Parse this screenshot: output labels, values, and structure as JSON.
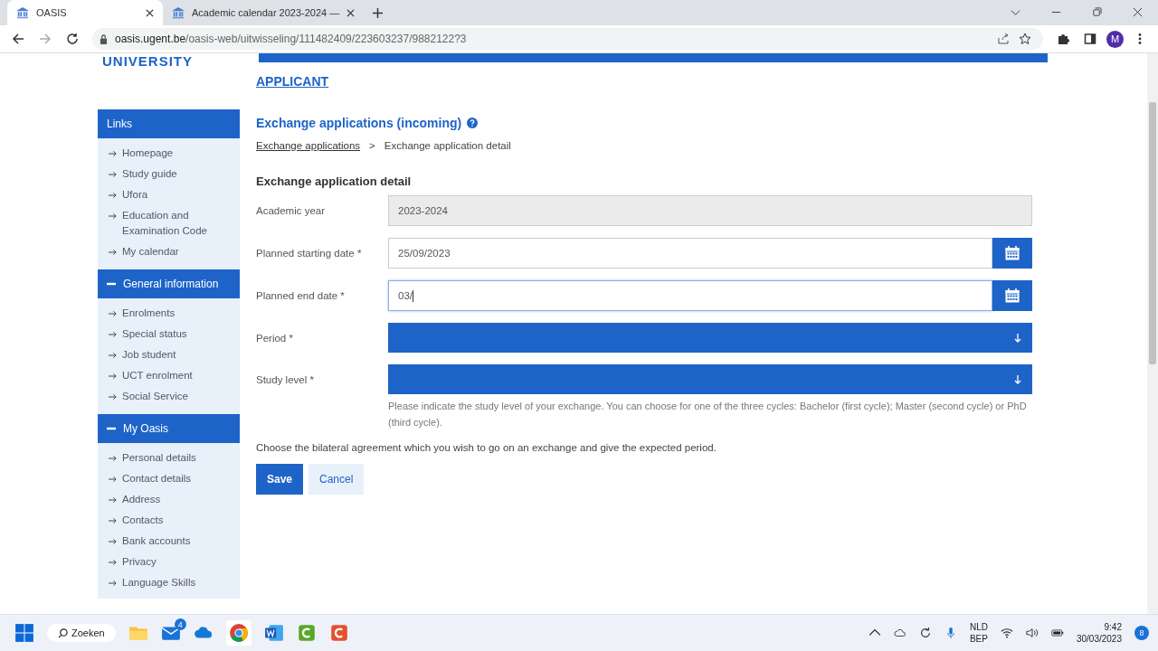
{
  "browser": {
    "tabs": [
      {
        "title": "OASIS",
        "selected": true
      },
      {
        "title": "Academic calendar 2023-2024 —",
        "selected": false
      }
    ],
    "url": {
      "host": "oasis.ugent.be",
      "path": "/oasis-web/uitwisseling/111482409/223603237/9882122?3"
    },
    "profile": "M"
  },
  "page": {
    "logo_text": "UNIVERSITY",
    "section_link": "APPLICANT",
    "sidebar": [
      {
        "title": "Links",
        "kind": "header",
        "items": [
          "Homepage",
          "Study guide",
          "Ufora",
          "Education and Examination Code",
          "My calendar"
        ]
      },
      {
        "title": "General information",
        "kind": "toggle",
        "expanded": true,
        "items": [
          "Enrolments",
          "Special status",
          "Job student",
          "UCT enrolment",
          "Social Service"
        ]
      },
      {
        "title": "My Oasis",
        "kind": "toggle",
        "expanded": true,
        "items": [
          "Personal details",
          "Contact details",
          "Address",
          "Contacts",
          "Bank accounts",
          "Privacy",
          "Language Skills"
        ]
      }
    ],
    "heading": "Exchange applications (incoming)",
    "breadcrumb": {
      "items": [
        {
          "label": "Exchange applications",
          "link": true
        },
        {
          "label": "Exchange application detail",
          "link": false
        }
      ],
      "separator": ">"
    },
    "form_title": "Exchange application detail",
    "fields": [
      {
        "label": "Academic year",
        "kind": "readonly",
        "value": "2023-2024"
      },
      {
        "label": "Planned starting date *",
        "kind": "date",
        "value": "25/09/2023",
        "focused": false
      },
      {
        "label": "Planned end date *",
        "kind": "date",
        "value": "03/",
        "focused": true
      },
      {
        "label": "Period *",
        "kind": "select"
      },
      {
        "label": "Study level *",
        "kind": "select",
        "help": "Please indicate the study level of your exchange. You can choose for one of the three cycles: Bachelor (first cycle); Master (second cycle) or PhD (third cycle)."
      }
    ],
    "note": "Choose the bilateral agreement which you wish to go on an exchange and give the expected period.",
    "buttons": [
      {
        "label": "Save",
        "kind": "primary"
      },
      {
        "label": "Cancel",
        "kind": "secondary"
      }
    ]
  },
  "taskbar": {
    "search": "Zoeken",
    "mail_badge": "4",
    "language": "NLD",
    "layout": "BEP",
    "time": "9:42",
    "date": "30/03/2023",
    "notifications": "8"
  }
}
